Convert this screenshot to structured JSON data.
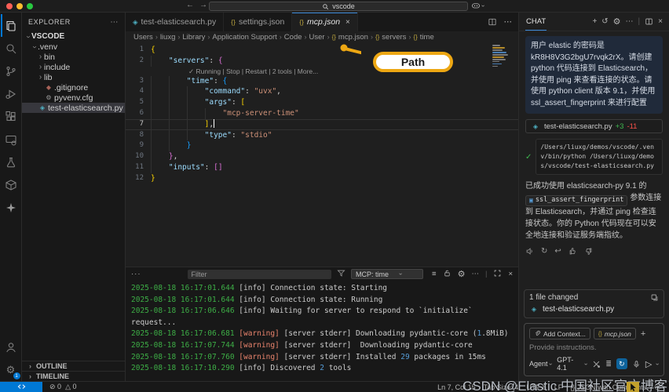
{
  "titlebar": {
    "search_value": "vscode"
  },
  "activity_badge": "1",
  "explorer": {
    "header": "EXPLORER",
    "items": [
      {
        "label": "VSCODE",
        "chev": "open",
        "bold": true,
        "indent": 0
      },
      {
        "label": ".venv",
        "chev": "open",
        "indent": 1
      },
      {
        "label": "bin",
        "chev": "closed",
        "indent": 2
      },
      {
        "label": "include",
        "chev": "closed",
        "indent": 2
      },
      {
        "label": "lib",
        "chev": "closed",
        "indent": 2
      },
      {
        "label": ".gitignore",
        "icon": "diamond",
        "color": "#a86258",
        "indent": 2
      },
      {
        "label": "pyvenv.cfg",
        "icon": "gear",
        "color": "#9a9a9a",
        "indent": 2
      },
      {
        "label": "test-elasticsearch.py",
        "icon": "python",
        "color": "#4fb3c6",
        "indent": 1,
        "selected": true
      }
    ],
    "sections": [
      "OUTLINE",
      "TIMELINE"
    ]
  },
  "tabs": [
    {
      "label": "test-elasticsearch.py",
      "icon": "python",
      "color": "#4fb3c6"
    },
    {
      "label": "settings.json",
      "icon": "json",
      "color": "#b9a23d"
    },
    {
      "label": "mcp.json",
      "icon": "json",
      "color": "#b9a23d",
      "active": true,
      "close": true
    }
  ],
  "breadcrumb": [
    {
      "label": "Users"
    },
    {
      "label": "liuxg"
    },
    {
      "label": "Library"
    },
    {
      "label": "Application Support"
    },
    {
      "label": "Code"
    },
    {
      "label": "User"
    },
    {
      "label": "mcp.json",
      "sym": true
    },
    {
      "label": "servers",
      "sym": true
    },
    {
      "label": "time",
      "sym": true
    }
  ],
  "editor": {
    "codelens": "✓ Running | Stop | Restart | 2 tools | More...",
    "lines": [
      {
        "n": "1",
        "i": 0,
        "s": [
          [
            "{",
            "b1"
          ]
        ]
      },
      {
        "n": "2",
        "i": 1,
        "s": [
          [
            "\"servers\"",
            "k"
          ],
          [
            ": ",
            "p"
          ],
          [
            "{",
            "b2"
          ]
        ]
      },
      {
        "lens": true
      },
      {
        "n": "3",
        "i": 2,
        "s": [
          [
            "\"time\"",
            "k"
          ],
          [
            ": ",
            "p"
          ],
          [
            "{",
            "b3"
          ]
        ]
      },
      {
        "n": "4",
        "i": 3,
        "s": [
          [
            "\"command\"",
            "k"
          ],
          [
            ": ",
            "p"
          ],
          [
            "\"uvx\"",
            "s"
          ],
          [
            ",",
            "p"
          ]
        ]
      },
      {
        "n": "5",
        "i": 3,
        "s": [
          [
            "\"args\"",
            "k"
          ],
          [
            ": ",
            "p"
          ],
          [
            "[",
            "b1"
          ]
        ]
      },
      {
        "n": "6",
        "i": 4,
        "s": [
          [
            "\"mcp-server-time\"",
            "s"
          ]
        ]
      },
      {
        "n": "7",
        "i": 3,
        "s": [
          [
            "]",
            "b1"
          ],
          [
            ",",
            "p"
          ]
        ],
        "current": true,
        "cursor": true
      },
      {
        "n": "8",
        "i": 3,
        "s": [
          [
            "\"type\"",
            "k"
          ],
          [
            ": ",
            "p"
          ],
          [
            "\"stdio\"",
            "s"
          ]
        ]
      },
      {
        "n": "9",
        "i": 2,
        "s": [
          [
            "}",
            "b3"
          ]
        ]
      },
      {
        "n": "10",
        "i": 1,
        "s": [
          [
            "}",
            "b2"
          ],
          [
            ",",
            "p"
          ]
        ]
      },
      {
        "n": "11",
        "i": 1,
        "s": [
          [
            "\"inputs\"",
            "k"
          ],
          [
            ": ",
            "p"
          ],
          [
            "[]",
            "b2"
          ]
        ]
      },
      {
        "n": "12",
        "i": 0,
        "s": [
          [
            "}",
            "b1"
          ]
        ]
      }
    ]
  },
  "callout": {
    "label": "Path"
  },
  "panel": {
    "overflow": "···",
    "filter_placeholder": "Filter",
    "scope": "MCP: time",
    "log": [
      [
        [
          "2025-08-18 16:17:01.644",
          "t"
        ],
        [
          " [info] Connection state: Starting",
          "d"
        ]
      ],
      [
        [
          "2025-08-18 16:17:01.644",
          "t"
        ],
        [
          " [info] Connection state: Running",
          "d"
        ]
      ],
      [
        [
          "2025-08-18 16:17:06.646",
          "t"
        ],
        [
          " [info] Waiting for server to respond to `initialize`",
          "d"
        ]
      ],
      [
        [
          "request...",
          "d"
        ]
      ],
      [
        [
          "2025-08-18 16:17:06.681",
          "t"
        ],
        [
          " ",
          "d"
        ],
        [
          "[warning]",
          "w"
        ],
        [
          " [server stderr] Downloading pydantic-core (",
          "d"
        ],
        [
          "1",
          "n"
        ],
        [
          ".8MiB)",
          "d"
        ]
      ],
      [
        [
          "2025-08-18 16:17:07.744",
          "t"
        ],
        [
          " ",
          "d"
        ],
        [
          "[warning]",
          "w"
        ],
        [
          " [server stderr]  Downloading pydantic-core",
          "d"
        ]
      ],
      [
        [
          "2025-08-18 16:17:07.760",
          "t"
        ],
        [
          " ",
          "d"
        ],
        [
          "[warning]",
          "w"
        ],
        [
          " [server stderr] Installed ",
          "d"
        ],
        [
          "29",
          "n"
        ],
        [
          " packages in 15ms",
          "d"
        ]
      ],
      [
        [
          "2025-08-18 16:17:10.290",
          "t"
        ],
        [
          " [info] Discovered ",
          "d"
        ],
        [
          "2",
          "n"
        ],
        [
          " tools",
          "d"
        ]
      ]
    ]
  },
  "chat": {
    "title": "CHAT",
    "user_message": "用户 elastic 的密码是 kR8H8V3G2bgU7rvqk2rX。请创建 python 代码连接到 Elasticsearch，并使用 ping 来查看连接的状态。请使用 python client 版本 9.1，并使用 ssl_assert_fingerprint 来进行配置",
    "changed_file": {
      "name": "test-elasticsearch.py",
      "add": "+3",
      "del": "-11"
    },
    "command": "/Users/liuxg/demos/vscode/.venv/bin/python /Users/liuxg/demos/vscode/test-elasticsearch.py",
    "response_pre": "已成功使用 elasticsearch-py 9.1 的",
    "response_chip": "ssl_assert_fingerprint",
    "response_post": "参数连接到 Elasticsearch，并通过 ping 检查连接状态。你的 Python 代码现在可以安全地连接和验证服务端指纹。",
    "files_changed": "1 file changed",
    "file_name": "test-elasticsearch.py",
    "add_context": "Add Context...",
    "context_chip": "mcp.json",
    "placeholder": "Provide instructions.",
    "agent": "Agent",
    "model": "GPT-4.1"
  },
  "statusbar": {
    "errors": "0",
    "warnings": "0",
    "items": [
      "Ln 7, Col 15",
      "Tab Size: 4",
      "UTF-8",
      "LF",
      "{} JSON with Comments"
    ]
  },
  "watermark": "CSDN @Elastic 中国社区官方博客"
}
